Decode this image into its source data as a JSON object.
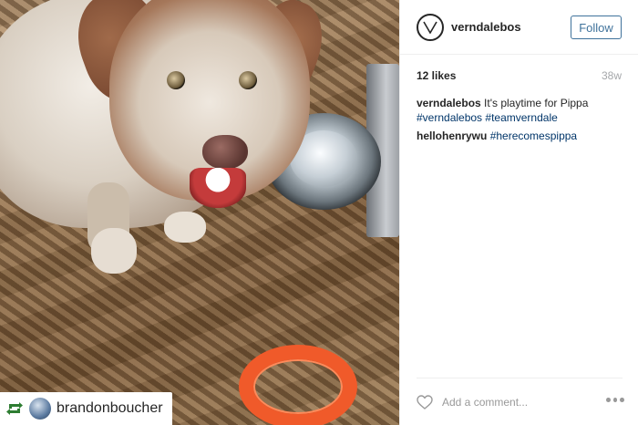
{
  "post": {
    "username": "verndalebos",
    "follow_label": "Follow",
    "likes": "12 likes",
    "time_ago": "38w",
    "caption": {
      "user": "verndalebos",
      "text": "It's playtime for Pippa",
      "tags": [
        "#verndalebos",
        "#teamverndale"
      ]
    },
    "comments": [
      {
        "user": "hellohenrywu",
        "tag": "#herecomespippa"
      }
    ],
    "add_comment_placeholder": "Add a comment...",
    "repost": {
      "icon": "repost-icon",
      "username": "brandonboucher"
    },
    "colors": {
      "follow_blue": "#3f729b",
      "hashtag_blue": "#003569",
      "meta_gray": "#a5a7aa"
    }
  }
}
